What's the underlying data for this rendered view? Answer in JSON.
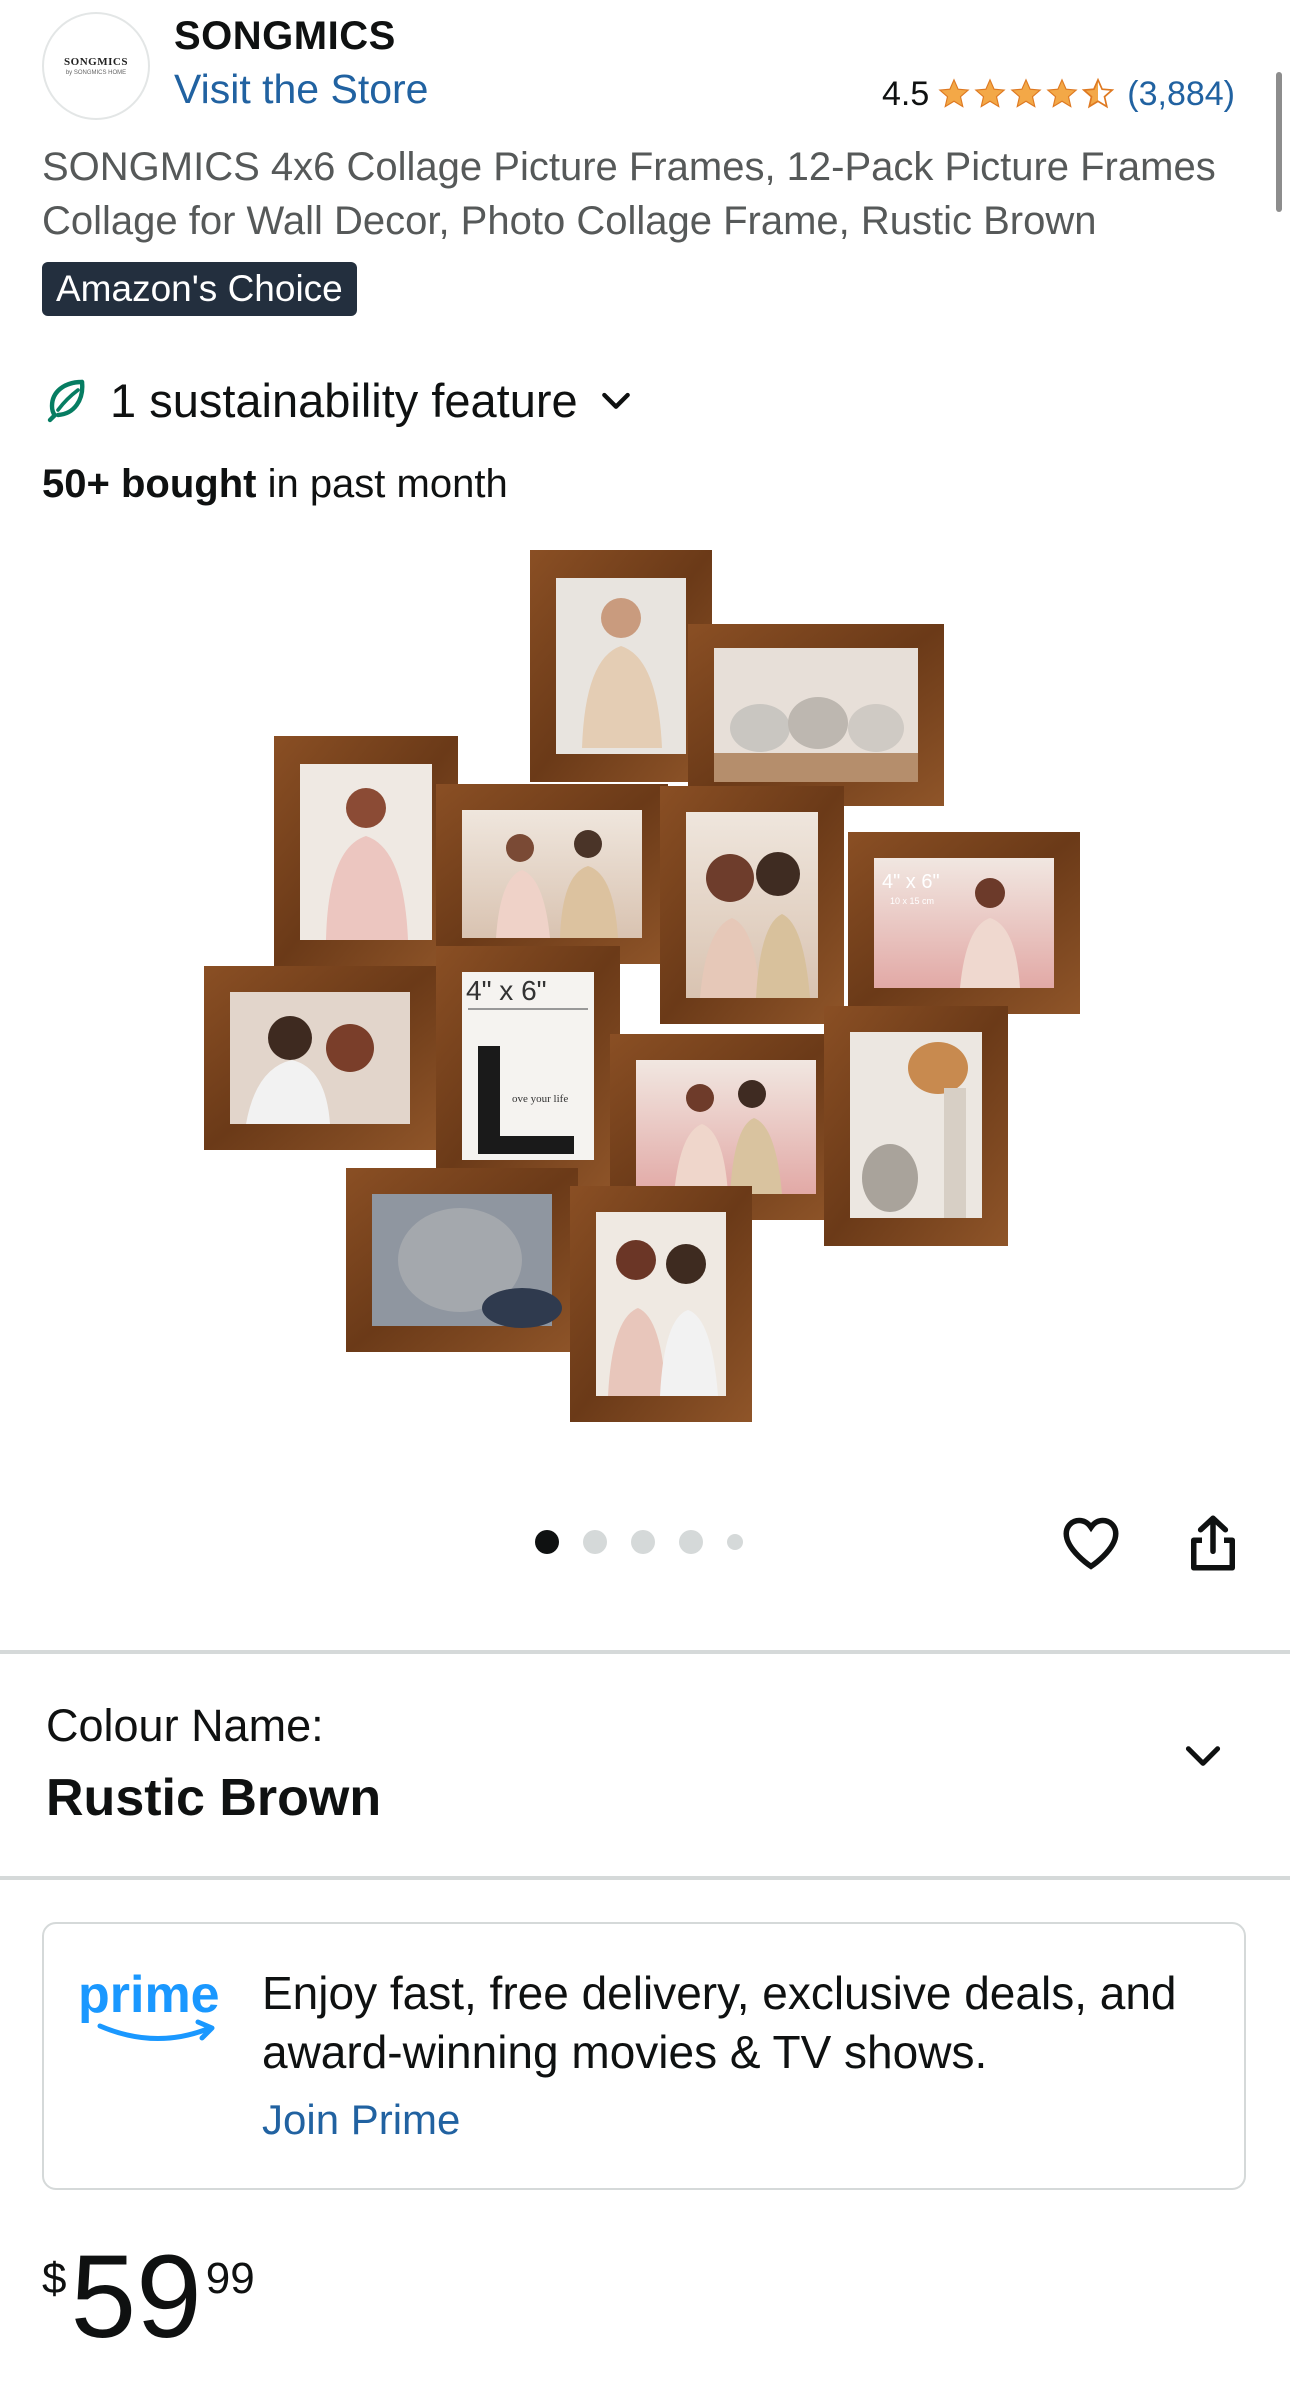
{
  "header": {
    "logo_text": "SONGMICS",
    "logo_subtext": "by SONGMICS HOME",
    "brand": "SONGMICS",
    "store_link": "Visit the Store",
    "rating": "4.5",
    "rating_value": 4.5,
    "review_count": "(3,884)"
  },
  "product": {
    "title": "SONGMICS 4x6 Collage Picture Frames, 12-Pack Picture Frames Collage for Wall Decor, Photo Collage Frame, Rustic Brown",
    "badge": "Amazon's Choice",
    "sustainability": "1 sustainability feature",
    "bought_bold": "50+ bought",
    "bought_rest": " in past month",
    "image_label_1": "4\" x 6\"",
    "image_label_2": "4\" x 6\"",
    "image_label_2_sub": "10 x 15 cm",
    "image_text": "ove your life"
  },
  "carousel": {
    "total_dots": 5,
    "active_index": 0
  },
  "colour": {
    "label": "Colour Name:",
    "value": "Rustic Brown"
  },
  "prime": {
    "logo": "prime",
    "text": "Enjoy fast, free delivery, exclusive deals, and award-winning movies & TV shows.",
    "link": "Join Prime"
  },
  "price": {
    "symbol": "$",
    "whole": "59",
    "fraction": "99"
  },
  "colors": {
    "link": "#2162a1",
    "star": "#f3a847",
    "badge_bg": "#232f3e",
    "frame": "#7a4520",
    "prime_blue": "#1a98ff"
  }
}
